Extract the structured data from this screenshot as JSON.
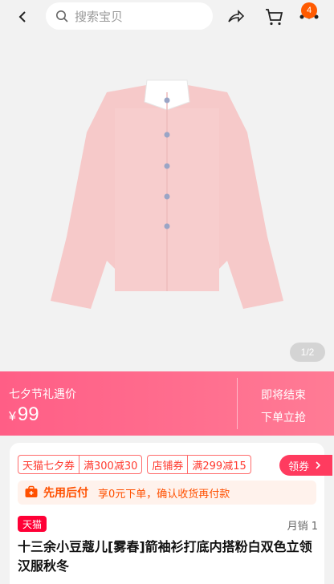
{
  "header": {
    "search_placeholder": "搜索宝贝",
    "cart_badge": "4",
    "back_icon": "chevron-left-icon",
    "share_icon": "share-icon",
    "cart_icon": "cart-icon",
    "more_icon": "more-icon"
  },
  "gallery": {
    "pager": "1/2"
  },
  "promo": {
    "label": "七夕节礼遇价",
    "currency": "¥",
    "price": "99",
    "ends": "即将结束",
    "buy": "下单立抢"
  },
  "coupons": [
    {
      "name": "天猫七夕券",
      "value": "满300减30"
    },
    {
      "name": "店铺券",
      "value": "满299减15"
    }
  ],
  "coupon_button": "领券",
  "pay_later": {
    "title": "先用后付",
    "desc": "享0元下单，确认收货再付款"
  },
  "store_tag": "天猫",
  "sales": "月销 1",
  "product_title": "十三余小豆蔻儿[雾春]箭袖衫打底内搭粉白双色立领汉服秋冬",
  "colors": {
    "accent": "#ff5000",
    "promo": "#ff6f8f",
    "tmall": "#ff0036",
    "shirt": "#f7cfcf"
  }
}
